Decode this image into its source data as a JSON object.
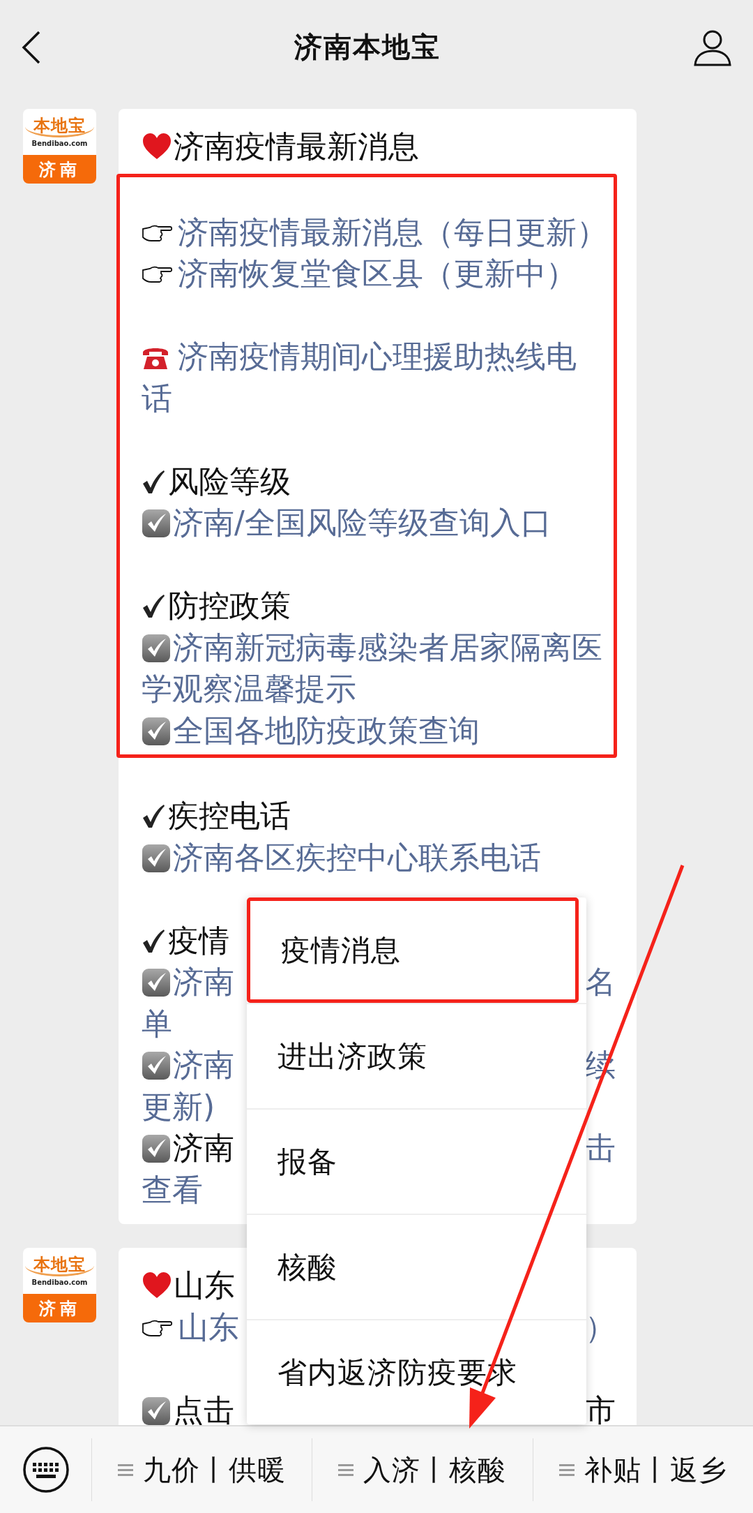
{
  "header": {
    "title": "济南本地宝"
  },
  "messages": [
    {
      "avatar": {
        "title": "本地宝",
        "domain": "Bendibao.com",
        "city": "济南"
      },
      "heading": {
        "kind": "heart",
        "text": "济南疫情最新消息"
      },
      "highlight_box": {
        "lines": [
          {
            "kind": "hand",
            "text": "济南疫情最新消息（每日更新）",
            "link": true,
            "gap": false
          },
          {
            "kind": "hand",
            "text": "济南恢复堂食区县（更新中）",
            "link": true,
            "gap": false
          },
          {
            "kind": "phone",
            "text": "济南疫情期间心理援助热线电",
            "link": true,
            "gap": true
          },
          {
            "text": "话",
            "link": true,
            "gap": false
          },
          {
            "kind": "check",
            "text": "风险等级",
            "link": false,
            "gap": true
          },
          {
            "kind": "checkbox",
            "text": "济南/全国风险等级查询入口",
            "link": true,
            "gap": false
          },
          {
            "kind": "check",
            "text": "防控政策",
            "link": false,
            "gap": true
          },
          {
            "kind": "checkbox",
            "text": "济南新冠病毒感染者居家隔离医",
            "link": true,
            "gap": false
          },
          {
            "text": "学观察温馨提示",
            "link": true,
            "gap": false
          },
          {
            "kind": "checkbox",
            "text": "全国各地防疫政策查询",
            "link": true,
            "gap": false
          }
        ]
      },
      "lines": [
        {
          "kind": "check",
          "text": "疾控电话",
          "link": false,
          "gap": false
        },
        {
          "kind": "checkbox",
          "text": "济南各区疾控中心联系电话",
          "link": true,
          "gap": false
        },
        {
          "kind": "check",
          "text": "疫情",
          "link": false,
          "gap": true
        },
        {
          "kind": "checkbox",
          "text": "济南",
          "tail": "名",
          "link": true,
          "gap": false
        },
        {
          "text": "单",
          "link": true,
          "gap": false
        },
        {
          "kind": "checkbox",
          "text": "济南",
          "tail": "续",
          "link": true,
          "gap": false
        },
        {
          "text": "更新)",
          "link": true,
          "gap": false
        },
        {
          "kind": "checkbox",
          "text": "济南",
          "tail": "击",
          "link": false,
          "tail_link": true,
          "gap": false
        },
        {
          "text": "查看",
          "link": true,
          "gap": false
        }
      ]
    },
    {
      "avatar": {
        "title": "本地宝",
        "domain": "Bendibao.com",
        "city": "济南"
      },
      "heading": {
        "kind": "heart",
        "text": "山东"
      },
      "lines": [
        {
          "kind": "hand",
          "text": "山东",
          "tail": "）",
          "link": true,
          "gap": false
        },
        {
          "kind": "checkbox",
          "text": "点击",
          "tail": "市",
          "link": false,
          "gap": true
        }
      ]
    }
  ],
  "popup_menu": {
    "items": [
      {
        "label": "疫情消息",
        "selected": true
      },
      {
        "label": "进出济政策",
        "selected": false
      },
      {
        "label": "报备",
        "selected": false
      },
      {
        "label": "核酸",
        "selected": false
      },
      {
        "label": "省内返济防疫要求",
        "selected": false
      }
    ]
  },
  "bottom_menu": {
    "items": [
      {
        "label": "九价丨供暖"
      },
      {
        "label": "入济丨核酸"
      },
      {
        "label": "补贴丨返乡"
      }
    ]
  }
}
